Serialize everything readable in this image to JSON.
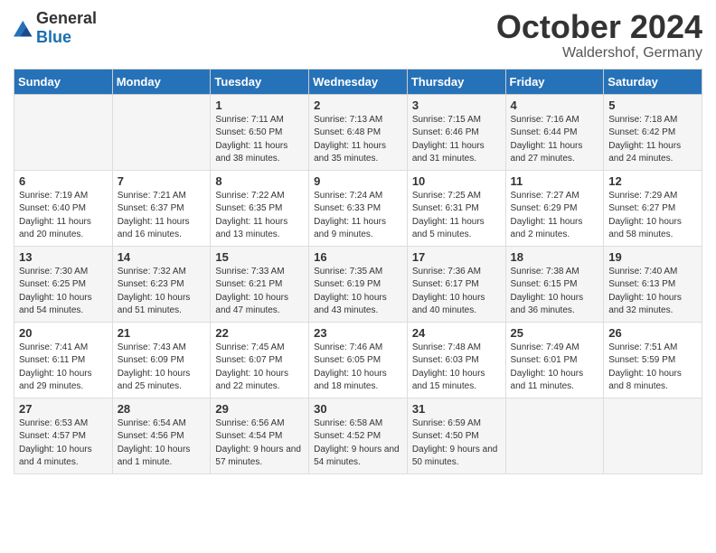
{
  "logo": {
    "general": "General",
    "blue": "Blue"
  },
  "title": "October 2024",
  "location": "Waldershof, Germany",
  "weekdays": [
    "Sunday",
    "Monday",
    "Tuesday",
    "Wednesday",
    "Thursday",
    "Friday",
    "Saturday"
  ],
  "weeks": [
    [
      {
        "day": "",
        "info": ""
      },
      {
        "day": "",
        "info": ""
      },
      {
        "day": "1",
        "info": "Sunrise: 7:11 AM\nSunset: 6:50 PM\nDaylight: 11 hours and 38 minutes."
      },
      {
        "day": "2",
        "info": "Sunrise: 7:13 AM\nSunset: 6:48 PM\nDaylight: 11 hours and 35 minutes."
      },
      {
        "day": "3",
        "info": "Sunrise: 7:15 AM\nSunset: 6:46 PM\nDaylight: 11 hours and 31 minutes."
      },
      {
        "day": "4",
        "info": "Sunrise: 7:16 AM\nSunset: 6:44 PM\nDaylight: 11 hours and 27 minutes."
      },
      {
        "day": "5",
        "info": "Sunrise: 7:18 AM\nSunset: 6:42 PM\nDaylight: 11 hours and 24 minutes."
      }
    ],
    [
      {
        "day": "6",
        "info": "Sunrise: 7:19 AM\nSunset: 6:40 PM\nDaylight: 11 hours and 20 minutes."
      },
      {
        "day": "7",
        "info": "Sunrise: 7:21 AM\nSunset: 6:37 PM\nDaylight: 11 hours and 16 minutes."
      },
      {
        "day": "8",
        "info": "Sunrise: 7:22 AM\nSunset: 6:35 PM\nDaylight: 11 hours and 13 minutes."
      },
      {
        "day": "9",
        "info": "Sunrise: 7:24 AM\nSunset: 6:33 PM\nDaylight: 11 hours and 9 minutes."
      },
      {
        "day": "10",
        "info": "Sunrise: 7:25 AM\nSunset: 6:31 PM\nDaylight: 11 hours and 5 minutes."
      },
      {
        "day": "11",
        "info": "Sunrise: 7:27 AM\nSunset: 6:29 PM\nDaylight: 11 hours and 2 minutes."
      },
      {
        "day": "12",
        "info": "Sunrise: 7:29 AM\nSunset: 6:27 PM\nDaylight: 10 hours and 58 minutes."
      }
    ],
    [
      {
        "day": "13",
        "info": "Sunrise: 7:30 AM\nSunset: 6:25 PM\nDaylight: 10 hours and 54 minutes."
      },
      {
        "day": "14",
        "info": "Sunrise: 7:32 AM\nSunset: 6:23 PM\nDaylight: 10 hours and 51 minutes."
      },
      {
        "day": "15",
        "info": "Sunrise: 7:33 AM\nSunset: 6:21 PM\nDaylight: 10 hours and 47 minutes."
      },
      {
        "day": "16",
        "info": "Sunrise: 7:35 AM\nSunset: 6:19 PM\nDaylight: 10 hours and 43 minutes."
      },
      {
        "day": "17",
        "info": "Sunrise: 7:36 AM\nSunset: 6:17 PM\nDaylight: 10 hours and 40 minutes."
      },
      {
        "day": "18",
        "info": "Sunrise: 7:38 AM\nSunset: 6:15 PM\nDaylight: 10 hours and 36 minutes."
      },
      {
        "day": "19",
        "info": "Sunrise: 7:40 AM\nSunset: 6:13 PM\nDaylight: 10 hours and 32 minutes."
      }
    ],
    [
      {
        "day": "20",
        "info": "Sunrise: 7:41 AM\nSunset: 6:11 PM\nDaylight: 10 hours and 29 minutes."
      },
      {
        "day": "21",
        "info": "Sunrise: 7:43 AM\nSunset: 6:09 PM\nDaylight: 10 hours and 25 minutes."
      },
      {
        "day": "22",
        "info": "Sunrise: 7:45 AM\nSunset: 6:07 PM\nDaylight: 10 hours and 22 minutes."
      },
      {
        "day": "23",
        "info": "Sunrise: 7:46 AM\nSunset: 6:05 PM\nDaylight: 10 hours and 18 minutes."
      },
      {
        "day": "24",
        "info": "Sunrise: 7:48 AM\nSunset: 6:03 PM\nDaylight: 10 hours and 15 minutes."
      },
      {
        "day": "25",
        "info": "Sunrise: 7:49 AM\nSunset: 6:01 PM\nDaylight: 10 hours and 11 minutes."
      },
      {
        "day": "26",
        "info": "Sunrise: 7:51 AM\nSunset: 5:59 PM\nDaylight: 10 hours and 8 minutes."
      }
    ],
    [
      {
        "day": "27",
        "info": "Sunrise: 6:53 AM\nSunset: 4:57 PM\nDaylight: 10 hours and 4 minutes."
      },
      {
        "day": "28",
        "info": "Sunrise: 6:54 AM\nSunset: 4:56 PM\nDaylight: 10 hours and 1 minute."
      },
      {
        "day": "29",
        "info": "Sunrise: 6:56 AM\nSunset: 4:54 PM\nDaylight: 9 hours and 57 minutes."
      },
      {
        "day": "30",
        "info": "Sunrise: 6:58 AM\nSunset: 4:52 PM\nDaylight: 9 hours and 54 minutes."
      },
      {
        "day": "31",
        "info": "Sunrise: 6:59 AM\nSunset: 4:50 PM\nDaylight: 9 hours and 50 minutes."
      },
      {
        "day": "",
        "info": ""
      },
      {
        "day": "",
        "info": ""
      }
    ]
  ]
}
